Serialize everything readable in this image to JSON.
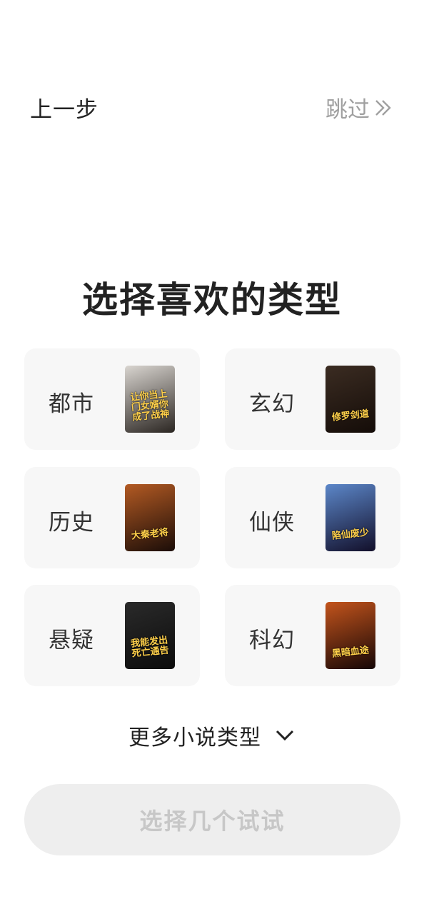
{
  "nav": {
    "back_label": "上一步",
    "skip_label": "跳过"
  },
  "title": "选择喜欢的类型",
  "genres": [
    {
      "label": "都市",
      "cover_text": "让你当上门女婿你成了战神",
      "colors": [
        "#d9d5d0",
        "#2b2622"
      ]
    },
    {
      "label": "玄幻",
      "cover_text": "修罗剑道",
      "colors": [
        "#3b2c22",
        "#140c08"
      ]
    },
    {
      "label": "历史",
      "cover_text": "大秦老将",
      "colors": [
        "#b35a23",
        "#1b0d08"
      ]
    },
    {
      "label": "仙侠",
      "cover_text": "陷仙废少",
      "colors": [
        "#5c87c9",
        "#120f2a"
      ]
    },
    {
      "label": "悬疑",
      "cover_text": "我能发出死亡通告",
      "colors": [
        "#2a2a2a",
        "#0c0c0c"
      ]
    },
    {
      "label": "科幻",
      "cover_text": "黑暗血途",
      "colors": [
        "#c3541c",
        "#150606"
      ]
    }
  ],
  "more_label": "更多小说类型",
  "cta_label": "选择几个试试"
}
